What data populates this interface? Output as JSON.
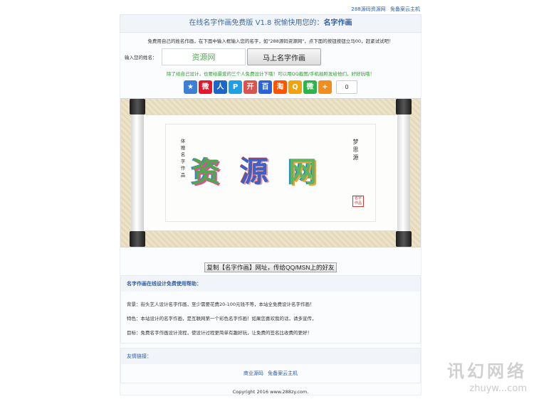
{
  "top_links": [
    "288源码资源网",
    "免备案云主机"
  ],
  "header": {
    "title_prefix": "在线名字作画免费版 V1.8 祝愉快用您的：",
    "title_highlight": "名字作画"
  },
  "intro": "免费用自己的姓名作画，在下面中输入框输入您的名字，如\"288源码资源网\"，点下面的按钮按钮立马00，赶紧试试吧！",
  "form": {
    "label": "输入您的姓名：",
    "value": "资源网",
    "button": "马上名字作画"
  },
  "tip": "除了给自己设计，也要给最爱的三个人免费设计下哦！可以用QQ截图/手机拍照发给他们，好好玩哦！",
  "share": {
    "icons": [
      {
        "name": "favorite-icon",
        "glyph": "★",
        "color": "#3d7fd6"
      },
      {
        "name": "weibo-icon",
        "glyph": "微",
        "color": "#e6162d"
      },
      {
        "name": "renren-icon",
        "glyph": "人",
        "color": "#1c66c9"
      },
      {
        "name": "tqq-icon",
        "glyph": "P",
        "color": "#1ea0e6"
      },
      {
        "name": "kaixin-icon",
        "glyph": "开",
        "color": "#d9534f"
      },
      {
        "name": "baidu-icon",
        "glyph": "百",
        "color": "#2d63d9"
      },
      {
        "name": "taobao-icon",
        "glyph": "淘",
        "color": "#ff5500"
      },
      {
        "name": "qzone-icon",
        "glyph": "Q",
        "color": "#f0a30a"
      },
      {
        "name": "wechat-icon",
        "glyph": "微",
        "color": "#2db34a"
      },
      {
        "name": "more-icon",
        "glyph": "+",
        "color": "#f28c1b"
      }
    ],
    "count": "0"
  },
  "artwork": {
    "chars": [
      "资",
      "源",
      "网"
    ],
    "left_text": "体赠名字作品",
    "right_text": "梦思源"
  },
  "copy_button": "复制【名字作画】网址，传给QQ/MSN上的好友",
  "help": {
    "title": "名字作画在线设计免费使用帮助：",
    "lines": [
      "背景：街头艺人设计名字作画，至少需要花费20-100元钱不等，本站全免费设计名字作画！",
      "特色：本站设计的名字作画，是互联网第一个彩色名字作画！如果您喜欢我的话，请多宣传，",
      "目标：免费名字作画设计流程，使设计过程更简单有趣好玩，让免费的签名比收费的更好！"
    ]
  },
  "links": {
    "title": "友情链接：",
    "items": [
      "商业源码",
      "免备案云主机"
    ]
  },
  "copyright": "Copyright 2016 www.288zy.com.",
  "watermark": {
    "text": "讯幻网络",
    "url": "zhuyw...com"
  }
}
